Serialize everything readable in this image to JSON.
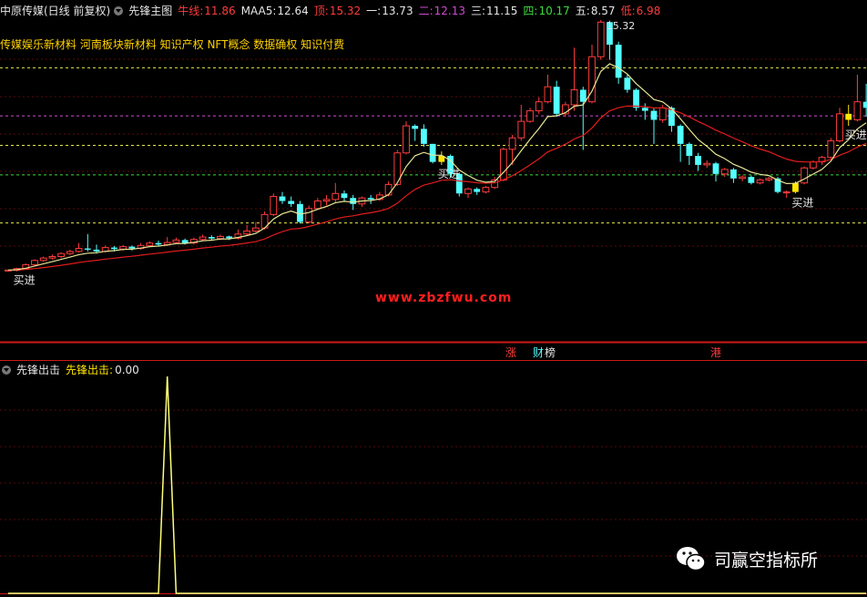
{
  "header": {
    "stock": "中原传媒(日线 前复权)",
    "indicator": "先锋主图",
    "items": [
      {
        "label": "牛线:",
        "value": "11.86",
        "color": "#ff3c3c"
      },
      {
        "label": "MAA5:",
        "value": "12.64",
        "color": "#e6e6e6"
      },
      {
        "label": "顶:",
        "value": "15.32",
        "color": "#ff3c3c"
      },
      {
        "label": "一:",
        "value": "13.73",
        "color": "#e6e6e6"
      },
      {
        "label": "二:",
        "value": "12.13",
        "color": "#d24bd2"
      },
      {
        "label": "三:",
        "value": "11.15",
        "color": "#e6e6e6"
      },
      {
        "label": "四:",
        "value": "10.17",
        "color": "#3cdc3c"
      },
      {
        "label": "五:",
        "value": "8.57",
        "color": "#e6e6e6"
      },
      {
        "label": "低:",
        "value": "6.98",
        "color": "#ff3c3c"
      }
    ]
  },
  "concepts": "传媒娱乐新材料 河南板块新材料 知识产权 NFT概念 数据确权 知识付费",
  "peak_label": "15.32",
  "signals": [
    {
      "text": "买进",
      "x": 0
    },
    {
      "text": "买进",
      "x": 0
    },
    {
      "text": "买进",
      "x": 0
    },
    {
      "text": "买进",
      "x": 0
    }
  ],
  "markers": [
    "涨",
    "财",
    "榜",
    "港"
  ],
  "watermark": "www.zbzfwu.com",
  "sub_header": {
    "name": "先锋出击",
    "label": "先锋出击:",
    "value": "0.00"
  },
  "brand": "司赢空指标所",
  "chart_data": [
    {
      "type": "candlestick",
      "title": "先锋主图",
      "levels": [
        {
          "name": "顶",
          "value": 15.32,
          "color": "#ff3c3c"
        },
        {
          "name": "一",
          "value": 13.73,
          "color": "#e6e64b"
        },
        {
          "name": "二",
          "value": 12.13,
          "color": "#d24bd2"
        },
        {
          "name": "三",
          "value": 11.15,
          "color": "#e6e64b"
        },
        {
          "name": "四",
          "value": 10.17,
          "color": "#3cdc3c"
        },
        {
          "name": "五",
          "value": 8.57,
          "color": "#e6e64b"
        },
        {
          "name": "低",
          "value": 6.98,
          "color": "#ff3c3c"
        }
      ],
      "ylim": [
        6.98,
        15.32
      ],
      "candles": [
        [
          6.98,
          7.0,
          6.95,
          7.02
        ],
        [
          6.99,
          7.05,
          6.96,
          7.08
        ],
        [
          7.05,
          7.18,
          7.02,
          7.22
        ],
        [
          7.18,
          7.32,
          7.15,
          7.36
        ],
        [
          7.32,
          7.4,
          7.28,
          7.45
        ],
        [
          7.4,
          7.45,
          7.35,
          7.52
        ],
        [
          7.45,
          7.55,
          7.4,
          7.6
        ],
        [
          7.55,
          7.62,
          7.5,
          7.68
        ],
        [
          7.62,
          7.72,
          7.58,
          7.9
        ],
        [
          7.72,
          7.68,
          7.62,
          8.2
        ],
        [
          7.68,
          7.62,
          7.55,
          7.85
        ],
        [
          7.62,
          7.75,
          7.58,
          7.82
        ],
        [
          7.75,
          7.7,
          7.62,
          7.8
        ],
        [
          7.7,
          7.78,
          7.65,
          7.84
        ],
        [
          7.78,
          7.72,
          7.65,
          7.82
        ],
        [
          7.72,
          7.82,
          7.68,
          7.9
        ],
        [
          7.82,
          7.9,
          7.78,
          7.96
        ],
        [
          7.9,
          7.85,
          7.8,
          7.98
        ],
        [
          7.85,
          7.92,
          7.8,
          8.1
        ],
        [
          7.92,
          8.0,
          7.88,
          8.08
        ],
        [
          8.0,
          7.9,
          7.85,
          8.05
        ],
        [
          7.9,
          8.02,
          7.85,
          8.08
        ],
        [
          8.02,
          8.1,
          7.98,
          8.18
        ],
        [
          8.1,
          8.05,
          7.98,
          8.16
        ],
        [
          8.05,
          8.12,
          8.0,
          8.18
        ],
        [
          8.12,
          8.06,
          8.0,
          8.15
        ],
        [
          8.06,
          8.2,
          8.02,
          8.35
        ],
        [
          8.2,
          8.3,
          8.15,
          8.5
        ],
        [
          8.3,
          8.4,
          8.25,
          8.6
        ],
        [
          8.4,
          8.85,
          8.35,
          8.95
        ],
        [
          8.85,
          9.45,
          8.8,
          9.55
        ],
        [
          9.45,
          9.3,
          9.2,
          9.6
        ],
        [
          9.3,
          9.2,
          9.1,
          9.45
        ],
        [
          9.2,
          8.6,
          8.55,
          9.3
        ],
        [
          8.6,
          9.05,
          8.55,
          9.15
        ],
        [
          9.05,
          9.3,
          9.0,
          9.4
        ],
        [
          9.3,
          9.35,
          9.15,
          9.5
        ],
        [
          9.35,
          9.55,
          9.25,
          9.9
        ],
        [
          9.55,
          9.4,
          9.3,
          9.65
        ],
        [
          9.4,
          9.2,
          9.0,
          9.5
        ],
        [
          9.2,
          9.4,
          9.1,
          9.45
        ],
        [
          9.4,
          9.35,
          9.2,
          9.5
        ],
        [
          9.35,
          9.5,
          9.3,
          9.6
        ],
        [
          9.5,
          9.85,
          9.45,
          9.95
        ],
        [
          9.85,
          10.9,
          9.8,
          11.0
        ],
        [
          10.9,
          11.8,
          10.85,
          11.95
        ],
        [
          11.8,
          11.7,
          11.3,
          11.85
        ],
        [
          11.7,
          11.2,
          11.1,
          11.85
        ],
        [
          11.2,
          10.6,
          10.55,
          11.2
        ],
        [
          10.6,
          10.8,
          10.5,
          10.95
        ],
        [
          10.8,
          10.2,
          10.1,
          10.85
        ],
        [
          10.2,
          9.55,
          9.45,
          10.25
        ],
        [
          9.55,
          9.7,
          9.4,
          9.75
        ],
        [
          9.7,
          9.6,
          9.5,
          9.75
        ],
        [
          9.6,
          9.75,
          9.55,
          9.8
        ],
        [
          9.75,
          10.0,
          9.7,
          10.1
        ],
        [
          10.0,
          11.02,
          9.95,
          11.08
        ],
        [
          11.02,
          11.4,
          10.5,
          11.5
        ],
        [
          11.4,
          11.95,
          11.3,
          12.5
        ],
        [
          11.95,
          12.3,
          11.9,
          12.4
        ],
        [
          12.3,
          12.6,
          12.2,
          12.75
        ],
        [
          12.6,
          13.1,
          12.55,
          13.5
        ],
        [
          13.1,
          12.2,
          12.1,
          13.3
        ],
        [
          12.2,
          12.5,
          12.1,
          12.6
        ],
        [
          12.5,
          13.0,
          12.3,
          14.4
        ],
        [
          13.0,
          12.6,
          11.0,
          13.1
        ],
        [
          12.6,
          14.1,
          12.55,
          14.5
        ],
        [
          14.1,
          15.25,
          14.0,
          15.32
        ],
        [
          15.25,
          14.5,
          14.0,
          15.3
        ],
        [
          14.5,
          13.4,
          13.2,
          14.6
        ],
        [
          13.4,
          13.0,
          12.9,
          13.5
        ],
        [
          13.0,
          12.4,
          12.3,
          13.05
        ],
        [
          12.4,
          12.3,
          12.0,
          12.55
        ],
        [
          12.3,
          12.0,
          11.2,
          12.4
        ],
        [
          12.0,
          12.4,
          11.9,
          12.5
        ],
        [
          12.4,
          11.8,
          11.6,
          12.45
        ],
        [
          11.8,
          11.2,
          10.6,
          11.85
        ],
        [
          11.2,
          10.8,
          10.5,
          11.25
        ],
        [
          10.8,
          10.5,
          10.3,
          10.9
        ],
        [
          10.5,
          10.55,
          10.4,
          10.65
        ],
        [
          10.55,
          10.2,
          9.95,
          10.6
        ],
        [
          10.2,
          10.35,
          10.1,
          10.4
        ],
        [
          10.35,
          10.05,
          9.9,
          10.4
        ],
        [
          10.05,
          10.1,
          9.95,
          10.15
        ],
        [
          10.1,
          9.9,
          9.85,
          10.15
        ],
        [
          9.9,
          10.0,
          9.85,
          10.05
        ],
        [
          10.0,
          10.05,
          9.95,
          10.1
        ],
        [
          10.05,
          9.6,
          9.55,
          10.1
        ],
        [
          9.6,
          9.6,
          9.4,
          9.65
        ],
        [
          9.6,
          9.9,
          9.55,
          9.95
        ],
        [
          9.9,
          10.4,
          9.85,
          10.45
        ],
        [
          10.4,
          10.6,
          10.35,
          10.65
        ],
        [
          10.6,
          10.75,
          10.5,
          10.8
        ],
        [
          10.75,
          11.3,
          10.7,
          11.4
        ],
        [
          11.3,
          12.2,
          11.25,
          12.4
        ],
        [
          12.2,
          12.0,
          11.8,
          12.5
        ],
        [
          12.0,
          12.6,
          11.95,
          13.5
        ],
        [
          12.6,
          12.4,
          12.1,
          13.2
        ]
      ],
      "ma_yellow": [],
      "ma_red": []
    },
    {
      "type": "line",
      "title": "先锋出击",
      "ylim": [
        0,
        1
      ],
      "values": [
        0,
        0,
        0,
        0,
        0,
        0,
        0,
        0,
        0,
        0,
        0,
        0,
        0,
        0,
        0,
        0,
        0,
        0,
        1,
        0,
        0,
        0,
        0,
        0,
        0,
        0,
        0,
        0,
        0,
        0,
        0,
        0,
        0,
        0,
        0,
        0,
        0,
        0,
        0,
        0,
        0,
        0,
        0,
        0,
        0,
        0,
        0,
        0,
        0,
        0,
        0,
        0,
        0,
        0,
        0,
        0,
        0,
        0,
        0,
        0,
        0,
        0,
        0,
        0,
        0,
        0,
        0,
        0,
        0,
        0,
        0,
        0,
        0,
        0,
        0,
        0,
        0,
        0,
        0,
        0,
        0,
        0,
        0,
        0,
        0,
        0,
        0,
        0,
        0,
        0,
        0,
        0,
        0,
        0,
        0,
        0,
        0,
        0
      ]
    }
  ]
}
